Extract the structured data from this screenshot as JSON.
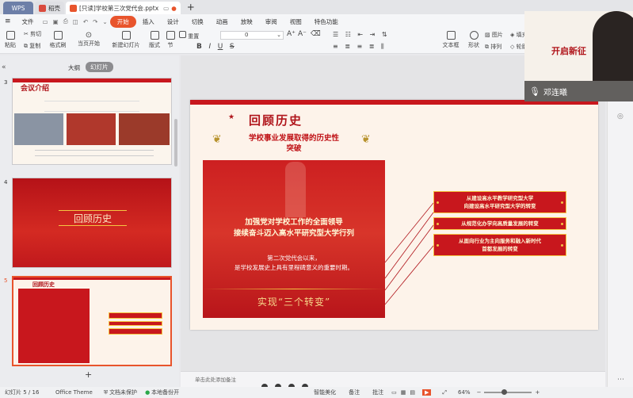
{
  "tabs": [
    {
      "label": "WPS"
    },
    {
      "label": "稻壳"
    },
    {
      "label": "[只读]学校第三次党代会.pptx"
    }
  ],
  "menu": {
    "file": "文件",
    "start": "开始",
    "insert": "插入",
    "design": "设计",
    "switch": "切换",
    "animation": "动画",
    "show": "放映",
    "review": "审阅",
    "view": "视图",
    "special": "特色功能"
  },
  "ribbon": {
    "paste": "粘贴",
    "cut": "剪切",
    "copy": "复制",
    "format_painter": "格式刷",
    "from_current": "当页开始",
    "new_slide": "新建幻灯片",
    "layout": "版式",
    "section": "节",
    "reset": "重置",
    "font_size": "0",
    "textbox": "文本框",
    "shape": "形状",
    "picture": "图片",
    "arrange": "排列",
    "fill": "填充",
    "outline": "轮廓"
  },
  "panel": {
    "outline": "大纲",
    "slides": "幻灯片"
  },
  "thumbs": [
    {
      "num": "3",
      "title": "会议介绍"
    },
    {
      "num": "4",
      "title": "回顾历史"
    },
    {
      "num": "5",
      "title": "回顾历史"
    }
  ],
  "slide": {
    "title": "回顾历史",
    "banner": "学校事业发展取得的历史性突破",
    "big1": "加强党对学校工作的全面领导",
    "big2": "接续奋斗迈入高水平研究型大学行列",
    "small1": "第二次党代会以来，",
    "small2": "是学校发展史上具有里程碑意义的重要时期。",
    "bottom": "实现“三个转变”",
    "items": [
      {
        "line1": "从建设高水平教学研究型大学",
        "line2": "向建设高水平研究型大学的转变"
      },
      {
        "line1": "从规范化办学向高质量发展的转变",
        "line2": ""
      },
      {
        "line1": "从面向行业为主向服务和融入新时代",
        "line2": "首都发展的转变"
      }
    ]
  },
  "notes_placeholder": "单击此处添加备注",
  "video": {
    "name": "邓连曦",
    "bg_text": "开启新征"
  },
  "status": {
    "slide_num": "幻灯片 5 / 16",
    "theme": "Office Theme",
    "protect": "文档未保护",
    "backup": "本地备份开",
    "beautify": "智能美化",
    "notes": "备注",
    "comments": "批注",
    "zoom": "64%"
  },
  "colors": {
    "accent": "#e8542c",
    "slide_red": "#c8171d",
    "gold": "#f4c542"
  }
}
